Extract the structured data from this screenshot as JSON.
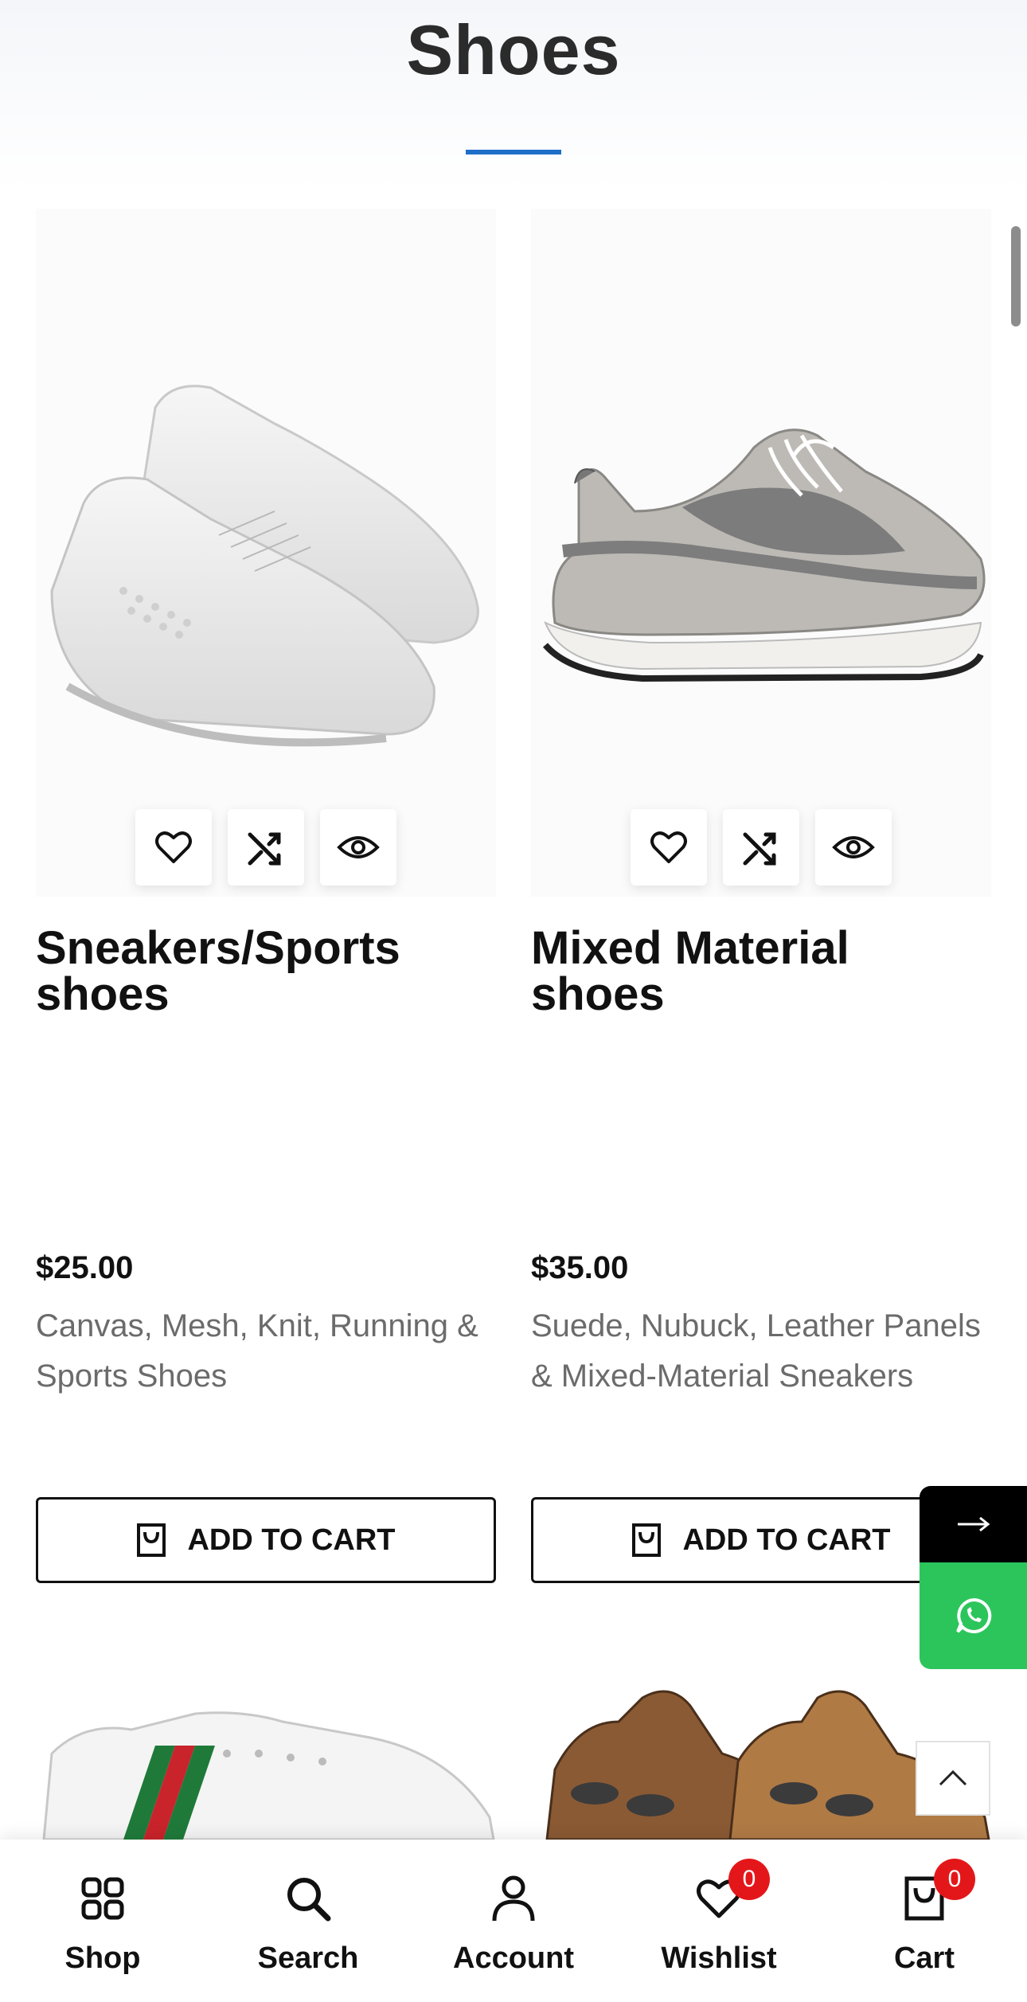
{
  "page": {
    "title": "Shoes",
    "accent_color": "#1f6fc8"
  },
  "products": [
    {
      "name": "Sneakers/Sports shoes",
      "price": "$25.00",
      "description": "Canvas, Mesh, Knit, Running & Sports Shoes",
      "add_to_cart_label": "ADD TO CART",
      "actions": [
        "heart-icon",
        "shuffle-icon",
        "eye-icon"
      ]
    },
    {
      "name": "Mixed Material shoes",
      "price": "$35.00",
      "description": "Suede, Nubuck, Leather Panels & Mixed-Material Sneakers",
      "add_to_cart_label": "ADD TO CART",
      "actions": [
        "heart-icon",
        "shuffle-icon",
        "eye-icon"
      ]
    }
  ],
  "floating": {
    "arrow_icon": "arrow-right-icon",
    "whatsapp_icon": "whatsapp-icon",
    "whatsapp_color": "#2cc55c",
    "back_to_top_icon": "chevron-up-icon"
  },
  "bottom_nav": {
    "items": [
      {
        "label": "Shop",
        "icon": "grid-icon"
      },
      {
        "label": "Search",
        "icon": "search-icon"
      },
      {
        "label": "Account",
        "icon": "user-icon"
      },
      {
        "label": "Wishlist",
        "icon": "heart-icon",
        "badge": "0"
      },
      {
        "label": "Cart",
        "icon": "bag-icon",
        "badge": "0"
      }
    ],
    "badge_color": "#e3171a"
  }
}
